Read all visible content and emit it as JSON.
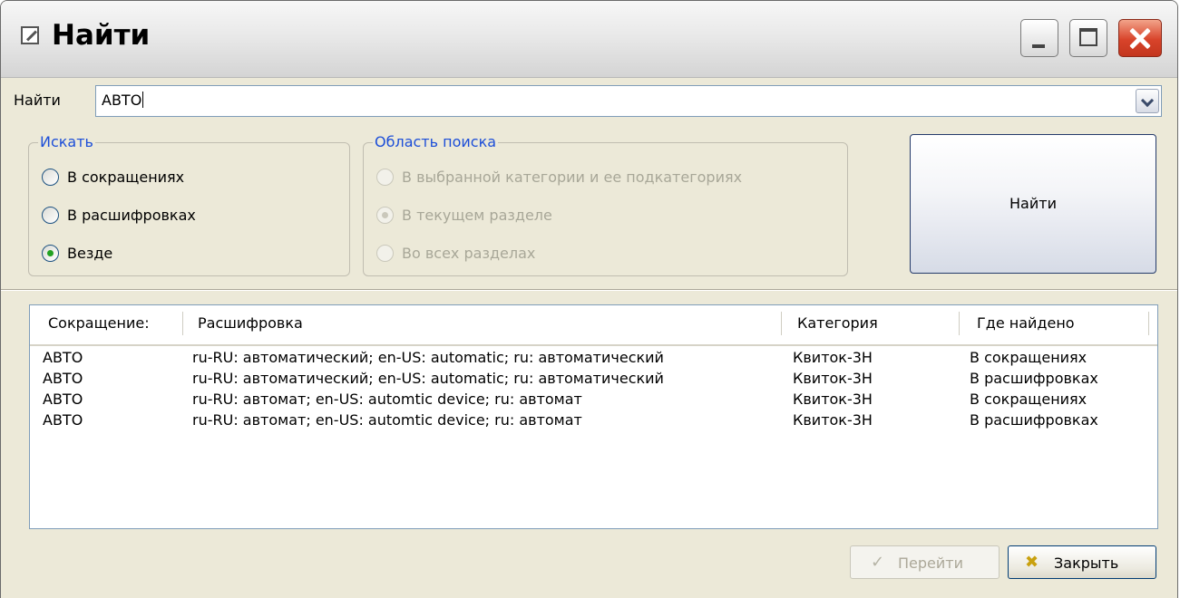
{
  "window": {
    "title": "Найти"
  },
  "search": {
    "label": "Найти",
    "value": "АВТО"
  },
  "search_in": {
    "legend": "Искать",
    "options": [
      {
        "label": "В сокращениях",
        "checked": false
      },
      {
        "label": "В расшифровках",
        "checked": false
      },
      {
        "label": "Везде",
        "checked": true
      }
    ]
  },
  "scope": {
    "legend": "Область поиска",
    "options": [
      {
        "label": "В выбранной категории и ее подкатегориях",
        "checked": false,
        "disabled": true
      },
      {
        "label": "В текущем разделе",
        "checked": true,
        "disabled": true
      },
      {
        "label": "Во всех разделах",
        "checked": false,
        "disabled": true
      }
    ]
  },
  "find_button": {
    "label": "Найти"
  },
  "results": {
    "columns": [
      "Сокращение:",
      "Расшифровка",
      "Категория",
      "Где найдено"
    ],
    "rows": [
      [
        "АВТО",
        "ru-RU: автоматический; en-US: automatic; ru: автоматический",
        "Квиток-3Н",
        "В сокращениях"
      ],
      [
        "АВТО",
        "ru-RU: автоматический; en-US: automatic; ru: автоматический",
        "Квиток-3Н",
        "В расшифровках"
      ],
      [
        "АВТО",
        "ru-RU: автомат; en-US: automtic device; ru: автомат",
        "Квиток-3Н",
        "В сокращениях"
      ],
      [
        "АВТО",
        "ru-RU: автомат; en-US: automtic device; ru: автомат",
        "Квиток-3Н",
        "В расшифровках"
      ]
    ]
  },
  "footer": {
    "goto": {
      "label": "Перейти",
      "icon": "checkmark-icon",
      "disabled": true
    },
    "close": {
      "label": "Закрыть",
      "icon": "close-x-icon"
    }
  },
  "colors": {
    "legend": "#1c4ed8",
    "radio_checked": "#21a121",
    "close_button": "#d8432a"
  }
}
